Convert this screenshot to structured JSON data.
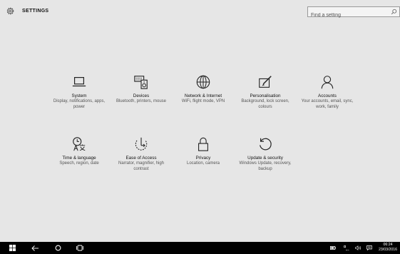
{
  "header": {
    "title": "SETTINGS",
    "search_placeholder": "Find a setting"
  },
  "tiles": [
    {
      "name": "System",
      "desc": "Display, notifications, apps, power",
      "icon": "laptop-icon"
    },
    {
      "name": "Devices",
      "desc": "Bluetooth, printers, mouse",
      "icon": "devices-icon"
    },
    {
      "name": "Network & Internet",
      "desc": "WiFi, flight mode, VPN",
      "icon": "globe-icon"
    },
    {
      "name": "Personalisation",
      "desc": "Background, lock screen, colours",
      "icon": "paint-icon"
    },
    {
      "name": "Accounts",
      "desc": "Your accounts, email, sync, work, family",
      "icon": "person-icon"
    },
    {
      "name": "Time & language",
      "desc": "Speech, region, date",
      "icon": "time-language-icon"
    },
    {
      "name": "Ease of Access",
      "desc": "Narrator, magnifier, high contrast",
      "icon": "ease-of-access-icon"
    },
    {
      "name": "Privacy",
      "desc": "Location, camera",
      "icon": "lock-icon"
    },
    {
      "name": "Update & security",
      "desc": "Windows Update, recovery, backup",
      "icon": "update-icon"
    }
  ],
  "taskbar": {
    "time": "06:24",
    "date": "23/03/2016"
  },
  "colors": {
    "background": "#e6e6e6",
    "taskbar": "#000000"
  }
}
